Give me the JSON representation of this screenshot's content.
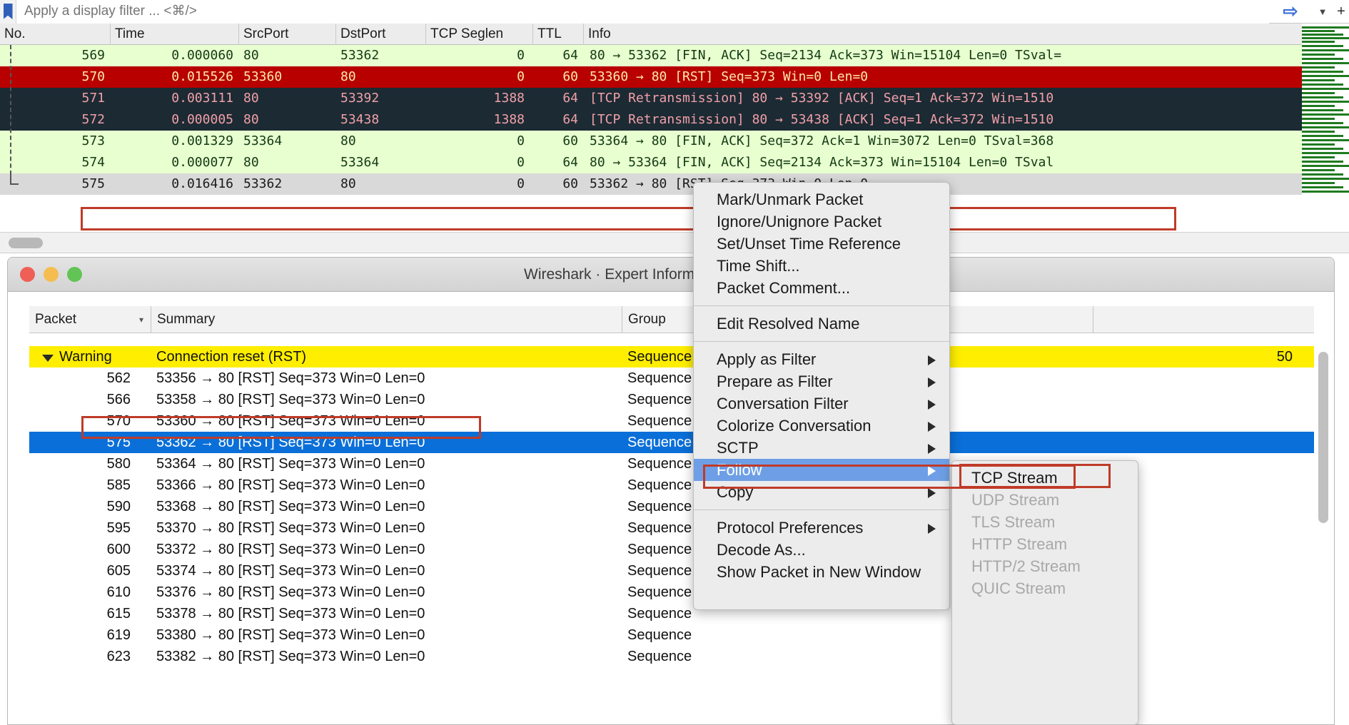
{
  "filter_bar": {
    "placeholder": "Apply a display filter ... <⌘/>",
    "value": "",
    "bookmark_icon": "bookmark-icon",
    "apply_icon": "arrow-right-icon",
    "history_icon": "chevron-down-icon",
    "add_icon": "plus-icon"
  },
  "packet_list": {
    "columns": [
      "No.",
      "Time",
      "SrcPort",
      "DstPort",
      "TCP Seglen",
      "TTL",
      "Info"
    ],
    "rows": [
      {
        "no": "569",
        "time": "0.000060",
        "src": "80",
        "dst": "53362",
        "seglen": "0",
        "ttl": "64",
        "info": "80 → 53362 [FIN, ACK] Seq=2134 Ack=373 Win=15104 Len=0 TSval=",
        "style": "green"
      },
      {
        "no": "570",
        "time": "0.015526",
        "src": "53360",
        "dst": "80",
        "seglen": "0",
        "ttl": "60",
        "info": "53360 → 80 [RST] Seq=373 Win=0 Len=0",
        "style": "red"
      },
      {
        "no": "571",
        "time": "0.003111",
        "src": "80",
        "dst": "53392",
        "seglen": "1388",
        "ttl": "64",
        "info": "[TCP Retransmission] 80 → 53392 [ACK] Seq=1 Ack=372 Win=1510",
        "style": "dark"
      },
      {
        "no": "572",
        "time": "0.000005",
        "src": "80",
        "dst": "53438",
        "seglen": "1388",
        "ttl": "64",
        "info": "[TCP Retransmission] 80 → 53438 [ACK] Seq=1 Ack=372 Win=1510",
        "style": "dark"
      },
      {
        "no": "573",
        "time": "0.001329",
        "src": "53364",
        "dst": "80",
        "seglen": "0",
        "ttl": "60",
        "info": "53364 → 80 [FIN, ACK] Seq=372 Ack=1 Win=3072 Len=0 TSval=368",
        "style": "green"
      },
      {
        "no": "574",
        "time": "0.000077",
        "src": "80",
        "dst": "53364",
        "seglen": "0",
        "ttl": "64",
        "info": "80 → 53364 [FIN, ACK] Seq=2134 Ack=373 Win=15104 Len=0 TSval",
        "style": "green"
      },
      {
        "no": "575",
        "time": "0.016416",
        "src": "53362",
        "dst": "80",
        "seglen": "0",
        "ttl": "60",
        "info": "53362 → 80 [RST] Seq=373 Win=0 Len=0",
        "style": "sel"
      }
    ]
  },
  "dialog": {
    "title": "Wireshark · Expert Information · eth0-via-UL",
    "close_button": "close-button",
    "minimize_button": "minimize-button",
    "maximize_button": "maximize-button",
    "columns": {
      "packet": "Packet",
      "summary": "Summary",
      "group": "Group",
      "count": ""
    },
    "rows": [
      {
        "packet": "Warning",
        "summary": "Connection reset (RST)",
        "group": "Sequence",
        "count": "50",
        "type": "group"
      },
      {
        "packet": "562",
        "summary": "53356 → 80 [RST] Seq=373 Win=0 Len=0",
        "group": "Sequence",
        "count": "",
        "type": "item"
      },
      {
        "packet": "566",
        "summary": "53358 → 80 [RST] Seq=373 Win=0 Len=0",
        "group": "Sequence",
        "count": "",
        "type": "item"
      },
      {
        "packet": "570",
        "summary": "53360 → 80 [RST] Seq=373 Win=0 Len=0",
        "group": "Sequence",
        "count": "",
        "type": "item"
      },
      {
        "packet": "575",
        "summary": "53362 → 80 [RST] Seq=373 Win=0 Len=0",
        "group": "Sequence",
        "count": "",
        "type": "selected"
      },
      {
        "packet": "580",
        "summary": "53364 → 80 [RST] Seq=373 Win=0 Len=0",
        "group": "Sequence",
        "count": "",
        "type": "item"
      },
      {
        "packet": "585",
        "summary": "53366 → 80 [RST] Seq=373 Win=0 Len=0",
        "group": "Sequence",
        "count": "",
        "type": "item"
      },
      {
        "packet": "590",
        "summary": "53368 → 80 [RST] Seq=373 Win=0 Len=0",
        "group": "Sequence",
        "count": "",
        "type": "item"
      },
      {
        "packet": "595",
        "summary": "53370 → 80 [RST] Seq=373 Win=0 Len=0",
        "group": "Sequence",
        "count": "",
        "type": "item"
      },
      {
        "packet": "600",
        "summary": "53372 → 80 [RST] Seq=373 Win=0 Len=0",
        "group": "Sequence",
        "count": "",
        "type": "item"
      },
      {
        "packet": "605",
        "summary": "53374 → 80 [RST] Seq=373 Win=0 Len=0",
        "group": "Sequence",
        "count": "",
        "type": "item"
      },
      {
        "packet": "610",
        "summary": "53376 → 80 [RST] Seq=373 Win=0 Len=0",
        "group": "Sequence",
        "count": "",
        "type": "item"
      },
      {
        "packet": "615",
        "summary": "53378 → 80 [RST] Seq=373 Win=0 Len=0",
        "group": "Sequence",
        "count": "",
        "type": "item"
      },
      {
        "packet": "619",
        "summary": "53380 → 80 [RST] Seq=373 Win=0 Len=0",
        "group": "Sequence",
        "count": "",
        "type": "item"
      },
      {
        "packet": "623",
        "summary": "53382 → 80 [RST] Seq=373 Win=0 Len=0",
        "group": "Sequence",
        "count": "",
        "type": "item"
      }
    ]
  },
  "context_menu": {
    "items": [
      {
        "label": "Mark/Unmark Packet",
        "submenu": false,
        "highlighted": false,
        "sep": false
      },
      {
        "label": "Ignore/Unignore Packet",
        "submenu": false,
        "highlighted": false,
        "sep": false
      },
      {
        "label": "Set/Unset Time Reference",
        "submenu": false,
        "highlighted": false,
        "sep": false
      },
      {
        "label": "Time Shift...",
        "submenu": false,
        "highlighted": false,
        "sep": false
      },
      {
        "label": "Packet Comment...",
        "submenu": false,
        "highlighted": false,
        "sep": true
      },
      {
        "label": "Edit Resolved Name",
        "submenu": false,
        "highlighted": false,
        "sep": true
      },
      {
        "label": "Apply as Filter",
        "submenu": true,
        "highlighted": false,
        "sep": false
      },
      {
        "label": "Prepare as Filter",
        "submenu": true,
        "highlighted": false,
        "sep": false
      },
      {
        "label": "Conversation Filter",
        "submenu": true,
        "highlighted": false,
        "sep": false
      },
      {
        "label": "Colorize Conversation",
        "submenu": true,
        "highlighted": false,
        "sep": false
      },
      {
        "label": "SCTP",
        "submenu": true,
        "highlighted": false,
        "sep": false
      },
      {
        "label": "Follow",
        "submenu": true,
        "highlighted": true,
        "sep": false
      },
      {
        "label": "Copy",
        "submenu": true,
        "highlighted": false,
        "sep": true
      },
      {
        "label": "Protocol Preferences",
        "submenu": true,
        "highlighted": false,
        "sep": false
      },
      {
        "label": "Decode As...",
        "submenu": false,
        "highlighted": false,
        "sep": false
      },
      {
        "label": "Show Packet in New Window",
        "submenu": false,
        "highlighted": false,
        "sep": false
      }
    ]
  },
  "submenu": {
    "items": [
      {
        "label": "TCP Stream",
        "disabled": false
      },
      {
        "label": "UDP Stream",
        "disabled": true
      },
      {
        "label": "TLS Stream",
        "disabled": true
      },
      {
        "label": "HTTP Stream",
        "disabled": true
      },
      {
        "label": "HTTP/2 Stream",
        "disabled": true
      },
      {
        "label": "QUIC Stream",
        "disabled": true
      }
    ]
  },
  "colors": {
    "highlight_box": "#bf3b28",
    "selection_blue": "#0a6fd8",
    "menu_highlight": "#6e9fe6",
    "warning_yellow": "#ffee00",
    "row_green": "#e8ffd0",
    "row_red": "#b80000",
    "row_dark": "#1c2a33"
  }
}
